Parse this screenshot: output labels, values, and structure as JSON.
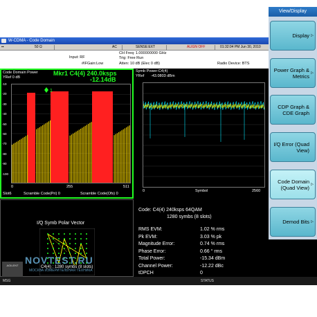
{
  "window": {
    "title": "W-CDMA - Code Domain",
    "controls": [
      "_",
      "□",
      "x"
    ]
  },
  "status_bar": {
    "impedance": "50 Ω",
    "coupling": "AC",
    "sense": "SENSE:EXT",
    "align": "ALIGN OFF",
    "datetime": "01:32:04 PM Jun 30, 2010"
  },
  "info": {
    "input": "Input: RF",
    "if_gain": "#IFGain:Low",
    "ch_freq": "CH Freq: 1.000000000 GHz",
    "trig": "Trig: Free Run",
    "atten": "Atten: 10 dB (Elec 0 dB)",
    "radio_device": "Radio Device: BTS"
  },
  "softkeys": {
    "menu_title": "View/Display",
    "items": [
      {
        "label": "Display",
        "arrow": "▷"
      },
      {
        "label": "Power Graph & Metrics",
        "arrow": "▷"
      },
      {
        "label": "CDP Graph & CDE Graph",
        "arrow": ""
      },
      {
        "label": "I/Q Error (Quad View)",
        "arrow": ""
      },
      {
        "label": "Code Domain (Quad View)",
        "arrow": "▷"
      },
      {
        "label": "Demod Bits",
        "arrow": "▷"
      }
    ]
  },
  "code_domain": {
    "title": "Code Domain Power",
    "ref": "YRef 0 dB",
    "marker_line1": "Mkr1 C4(4) 240.0ksps",
    "marker_line2": "-12.14dB",
    "marker_id": "1",
    "x_start": "0",
    "x_mid": "255",
    "x_end": "511",
    "footer_slot": "Slot6",
    "footer_pri": "Scramble Code(Pri) 0",
    "footer_ofs": "Scramble Code(Ofs) 0",
    "y_ticks": [
      "-10",
      "-20",
      "-30",
      "-40",
      "-50",
      "-60",
      "-70",
      "-80",
      "-90",
      "-100"
    ]
  },
  "symbol_power": {
    "title": "Symb Power:C4(4)",
    "ref": "YRef",
    "ref_value": "-43.0803 dBm",
    "x_start": "0",
    "x_label": "Symbol",
    "x_end": "2560"
  },
  "iq_polar": {
    "title": "I/Q Symb Polar Vector",
    "footer": "C4(4) : 1280 symbs (8 slots)"
  },
  "metrics": {
    "code_line1": "Code:    C4(4) 240ksps 64QAM",
    "code_line2": "1280 symbs (8 slots)",
    "rows": [
      {
        "label": "RMS EVM:",
        "value": "1.02 % rms"
      },
      {
        "label": "Pk EVM:",
        "value": "3.03 % pk"
      },
      {
        "label": "Magnitude Error:",
        "value": "0.74 % rms"
      },
      {
        "label": "Phase Error:",
        "value": "0.66 ° rms"
      },
      {
        "label": "Total Power:",
        "value": "-15.34 dBm"
      },
      {
        "label": "Channel Power:",
        "value": "-12.22 dBc"
      },
      {
        "label": "tDPCH",
        "value": "0"
      }
    ]
  },
  "bottom": {
    "left": "MSG",
    "status": "STATUS"
  },
  "watermark": {
    "text": "NOVTEST.RU",
    "sub": "МОСКВА ИЗМЕРИТЕЛЬНАЯ ТЕХНИКА",
    "logo": "AGILENT"
  },
  "colors": {
    "marker": "#22ff22",
    "bars_red": "#ff2020",
    "bars_yellow": "#e8c800",
    "trace_cyan": "#00e8ff",
    "trace_yellow": "#ffff00",
    "softkey": "#5ab7cd"
  }
}
